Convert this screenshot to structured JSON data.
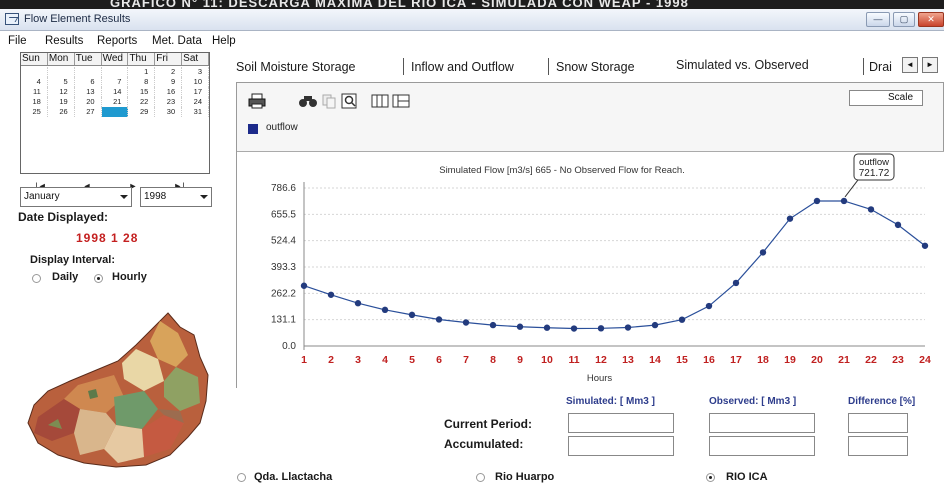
{
  "banner": {
    "text": "GRAFICO N° 11: DESCARGA MAXIMA DEL RIO ICA - SIMULADA CON WEAP - 1998"
  },
  "window": {
    "title": "Flow Element Results",
    "buttons": [
      "—",
      "▢",
      "✕"
    ]
  },
  "menu": {
    "items": [
      "File",
      "Results",
      "Reports",
      "Met. Data",
      "Help"
    ]
  },
  "calendar": {
    "days": [
      "Sun",
      "Mon",
      "Tue",
      "Wed",
      "Thu",
      "Fri",
      "Sat"
    ],
    "cells": [
      "",
      "",
      "",
      "",
      "1",
      "2",
      "3",
      "4",
      "5",
      "6",
      "7",
      "8",
      "9",
      "10",
      "11",
      "12",
      "13",
      "14",
      "15",
      "16",
      "17",
      "18",
      "19",
      "20",
      "21",
      "22",
      "23",
      "24",
      "25",
      "26",
      "27",
      "28",
      "29",
      "30",
      "31"
    ],
    "selected_day": "28",
    "nav": [
      "|◄",
      "◄",
      "►",
      "►|"
    ]
  },
  "month_select": {
    "value": "January"
  },
  "year_select": {
    "value": "1998"
  },
  "date_displayed": {
    "label": "Date Displayed:",
    "value": "1998 1 28"
  },
  "display_interval": {
    "label": "Display Interval:",
    "options": [
      "Daily",
      "Hourly"
    ],
    "selected": "Hourly"
  },
  "tabs": {
    "items": [
      "Soil Moisture Storage",
      "Inflow and Outflow",
      "Snow Storage",
      "Simulated vs. Observed",
      "Drai"
    ],
    "active": "Simulated vs. Observed",
    "scroll_left": "◄",
    "scroll_right": "►"
  },
  "toolbar": {
    "icons": [
      "print-icon",
      "binoculars-icon",
      "copy-icon",
      "zoom-icon",
      "table-icon",
      "chart-options-icon"
    ],
    "scale_label": "Scale"
  },
  "legend": {
    "label": "outflow",
    "color": "#1c2a8a"
  },
  "chart_data": {
    "type": "line",
    "title": "Simulated Flow [m3/s]  665  - No Observed Flow for Reach.",
    "xlabel": "Hours",
    "ylabel": "",
    "x": [
      1,
      2,
      3,
      4,
      5,
      6,
      7,
      8,
      9,
      10,
      11,
      12,
      13,
      14,
      15,
      16,
      17,
      18,
      19,
      20,
      21,
      22,
      23,
      24
    ],
    "y_ticks": [
      "0.0",
      "131.1",
      "262.2",
      "393.3",
      "524.4",
      "655.5",
      "786.6"
    ],
    "ylim": [
      0,
      786.6
    ],
    "series": [
      {
        "name": "outflow",
        "color": "#2a4f9a",
        "values": [
          300,
          255,
          213,
          180,
          155,
          132,
          117,
          104,
          96,
          91,
          87,
          88,
          92,
          104,
          131,
          199,
          314,
          466,
          634,
          722,
          722,
          680,
          603,
          499
        ]
      }
    ],
    "annotation": {
      "label": "outflow",
      "value": "721.72",
      "x": 21
    },
    "grid": true
  },
  "summary": {
    "headers": [
      "Simulated: [ Mm3 ]",
      "Observed: [ Mm3 ]",
      "Difference [%]"
    ],
    "rows": [
      "Current Period:",
      "Accumulated:"
    ]
  },
  "reaches": {
    "options": [
      "Qda. Llactacha",
      "Rio Huarpo",
      "RIO ICA"
    ],
    "selected": "RIO ICA"
  }
}
